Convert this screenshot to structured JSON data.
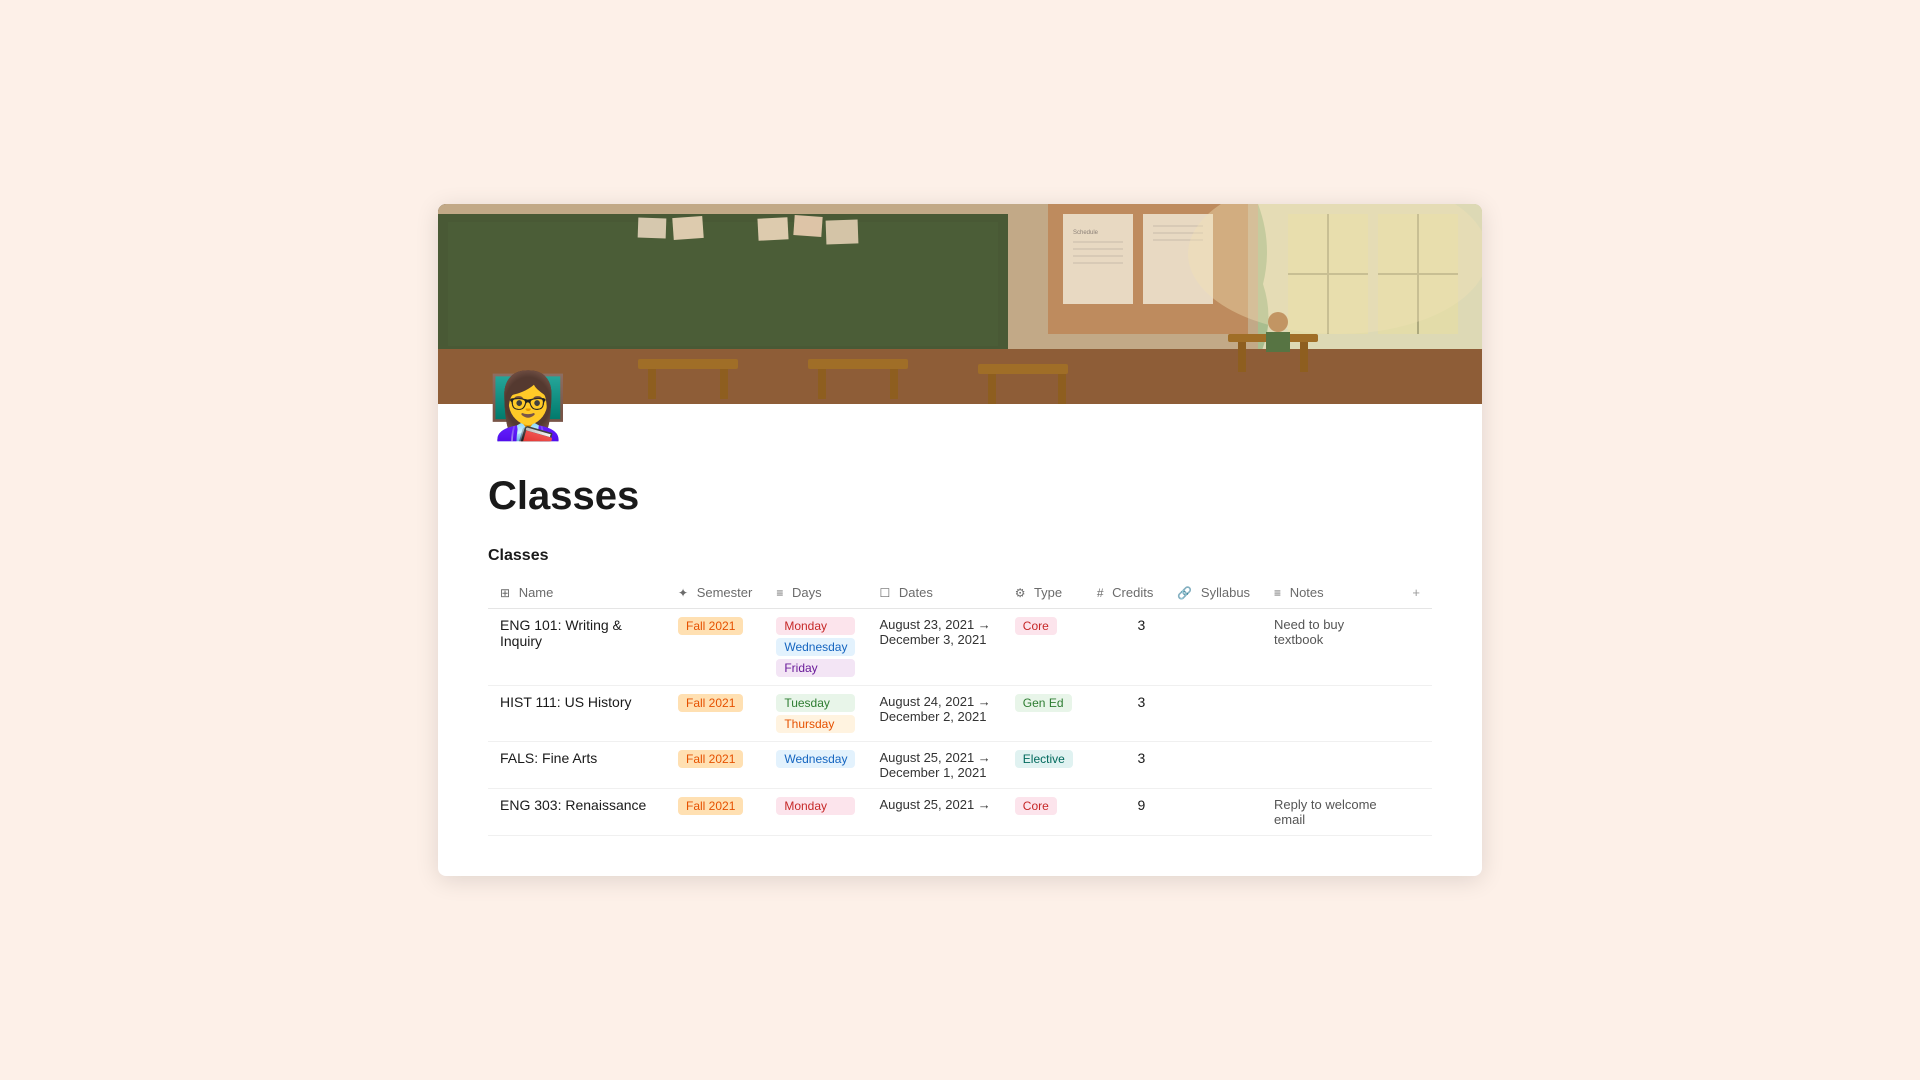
{
  "page": {
    "title": "Classes",
    "section_label": "Classes",
    "emoji_avatar": "👩‍🏫"
  },
  "table": {
    "columns": [
      {
        "id": "name",
        "icon": "person",
        "label": "Name"
      },
      {
        "id": "semester",
        "icon": "circle",
        "label": "Semester"
      },
      {
        "id": "days",
        "icon": "lines",
        "label": "Days"
      },
      {
        "id": "dates",
        "icon": "calendar",
        "label": "Dates"
      },
      {
        "id": "type",
        "icon": "gear",
        "label": "Type"
      },
      {
        "id": "credits",
        "icon": "hash",
        "label": "Credits"
      },
      {
        "id": "syllabus",
        "icon": "link",
        "label": "Syllabus"
      },
      {
        "id": "notes",
        "icon": "lines",
        "label": "Notes"
      }
    ],
    "rows": [
      {
        "name": "ENG 101: Writing & Inquiry",
        "semester": "Fall 2021",
        "days": [
          "Monday",
          "Wednesday",
          "Friday"
        ],
        "dates": "August 23, 2021 → December 3, 2021",
        "type": "Core",
        "credits": "3",
        "syllabus": "",
        "notes": "Need to buy textbook"
      },
      {
        "name": "HIST 111: US History",
        "semester": "Fall 2021",
        "days": [
          "Tuesday",
          "Thursday"
        ],
        "dates": "August 24, 2021 → December 2, 2021",
        "type": "Gen Ed",
        "credits": "3",
        "syllabus": "",
        "notes": ""
      },
      {
        "name": "FALS: Fine Arts",
        "semester": "Fall 2021",
        "days": [
          "Wednesday"
        ],
        "dates": "August 25, 2021 → December 1, 2021",
        "type": "Elective",
        "credits": "3",
        "syllabus": "",
        "notes": ""
      },
      {
        "name": "ENG 303: Renaissance",
        "semester": "Fall 2021",
        "days": [
          "Monday"
        ],
        "dates": "August 25, 2021 →",
        "type": "Core",
        "credits": "9",
        "syllabus": "",
        "notes": "Reply to welcome email"
      }
    ]
  }
}
